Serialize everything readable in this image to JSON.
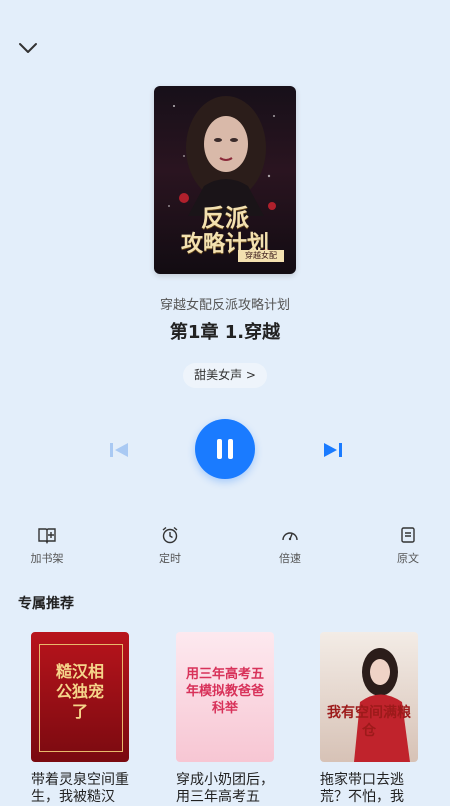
{
  "player": {
    "book_title": "穿越女配反派攻略计划",
    "chapter_title": "第1章 1.穿越",
    "voice_label": "甜美女声 >",
    "cover_text": {
      "line1": "反派",
      "line2": "攻略计划",
      "tag": "穿越女配"
    }
  },
  "controls": {
    "prev_icon": "skip-previous-icon",
    "play_state_icon": "pause-icon",
    "next_icon": "skip-next-icon",
    "accent_color": "#1a7bff"
  },
  "tools": [
    {
      "label": "加书架",
      "icon": "add-bookshelf-icon"
    },
    {
      "label": "定时",
      "icon": "alarm-clock-icon"
    },
    {
      "label": "倍速",
      "icon": "speedometer-icon"
    },
    {
      "label": "原文",
      "icon": "document-icon"
    }
  ],
  "recommend": {
    "heading": "专属推荐",
    "items": [
      {
        "title": "带着灵泉空间重生，我被糙汉",
        "cover_text": "糙汉相公独宠了"
      },
      {
        "title": "穿成小奶团后，用三年高考五",
        "cover_text": "用三年高考五年模拟教爸爸科举"
      },
      {
        "title": "拖家带口去逃荒？不怕，我",
        "cover_text": "我有空间满粮仓"
      }
    ]
  }
}
